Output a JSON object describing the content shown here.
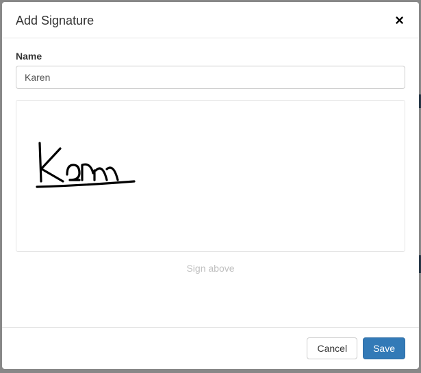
{
  "modal": {
    "title": "Add Signature",
    "close_label": "×"
  },
  "form": {
    "name_label": "Name",
    "name_value": "Karen"
  },
  "signature": {
    "caption": "Sign above"
  },
  "footer": {
    "cancel_label": "Cancel",
    "save_label": "Save"
  }
}
